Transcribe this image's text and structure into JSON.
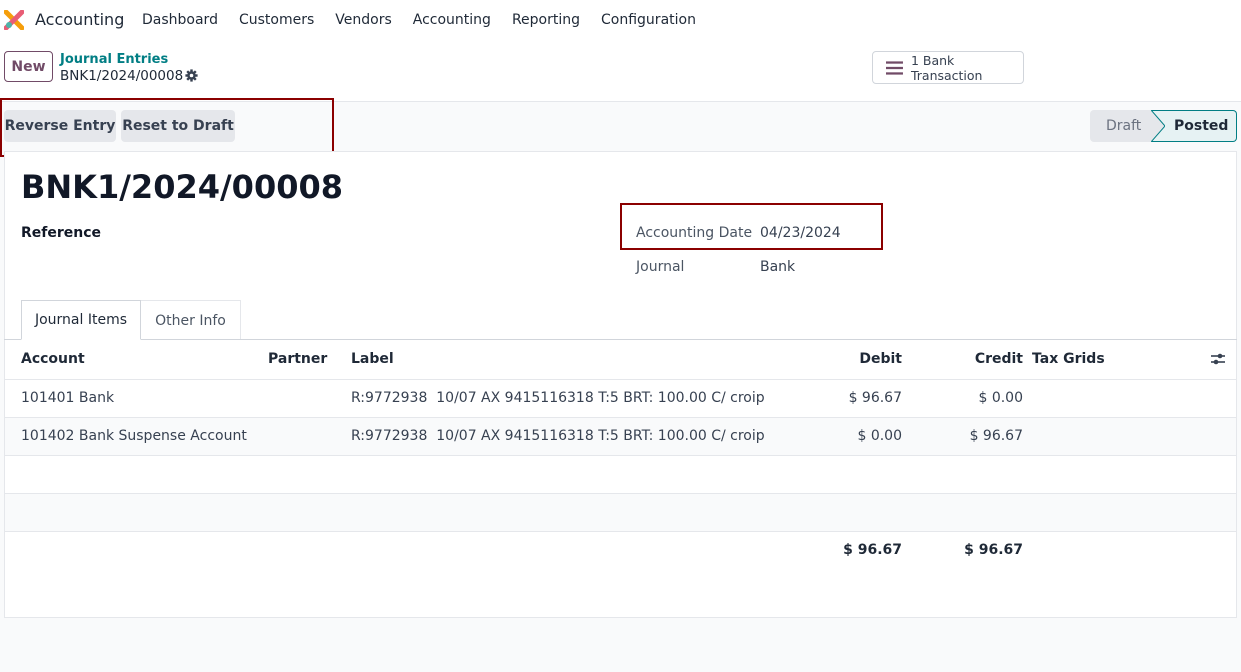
{
  "app": {
    "name": "Accounting"
  },
  "nav": [
    "Dashboard",
    "Customers",
    "Vendors",
    "Accounting",
    "Reporting",
    "Configuration"
  ],
  "control": {
    "new_label": "New",
    "breadcrumb": "Journal Entries",
    "record": "BNK1/2024/00008",
    "bank_button": "1 Bank Transaction"
  },
  "actions": {
    "reverse": "Reverse Entry",
    "reset": "Reset to Draft"
  },
  "status": {
    "draft": "Draft",
    "posted": "Posted",
    "current": "Posted"
  },
  "form": {
    "title": "BNK1/2024/00008",
    "reference_label": "Reference",
    "date_label": "Accounting Date",
    "date_value": "04/23/2024",
    "journal_label": "Journal",
    "journal_value": "Bank"
  },
  "tabs": [
    "Journal Items",
    "Other Info"
  ],
  "table": {
    "headers": {
      "account": "Account",
      "partner": "Partner",
      "label": "Label",
      "debit": "Debit",
      "credit": "Credit",
      "tax": "Tax Grids"
    },
    "rows": [
      {
        "account": "101401 Bank",
        "partner": "",
        "label": "R:9772938  10/07 AX 9415116318 T:5 BRT: 100.00 C/ croip",
        "debit": "$ 96.67",
        "credit": "$ 0.00",
        "tax": ""
      },
      {
        "account": "101402 Bank Suspense Account",
        "partner": "",
        "label": "R:9772938  10/07 AX 9415116318 T:5 BRT: 100.00 C/ croip",
        "debit": "$ 0.00",
        "credit": "$ 96.67",
        "tax": ""
      }
    ],
    "totals": {
      "debit": "$ 96.67",
      "credit": "$ 96.67"
    }
  },
  "colors": {
    "brand": "#714b67",
    "link": "#017e84",
    "highlight": "#8b0000"
  },
  "icons": [
    "app-logo-icon",
    "gear-icon",
    "hamburger-icon",
    "optional-columns-icon"
  ]
}
